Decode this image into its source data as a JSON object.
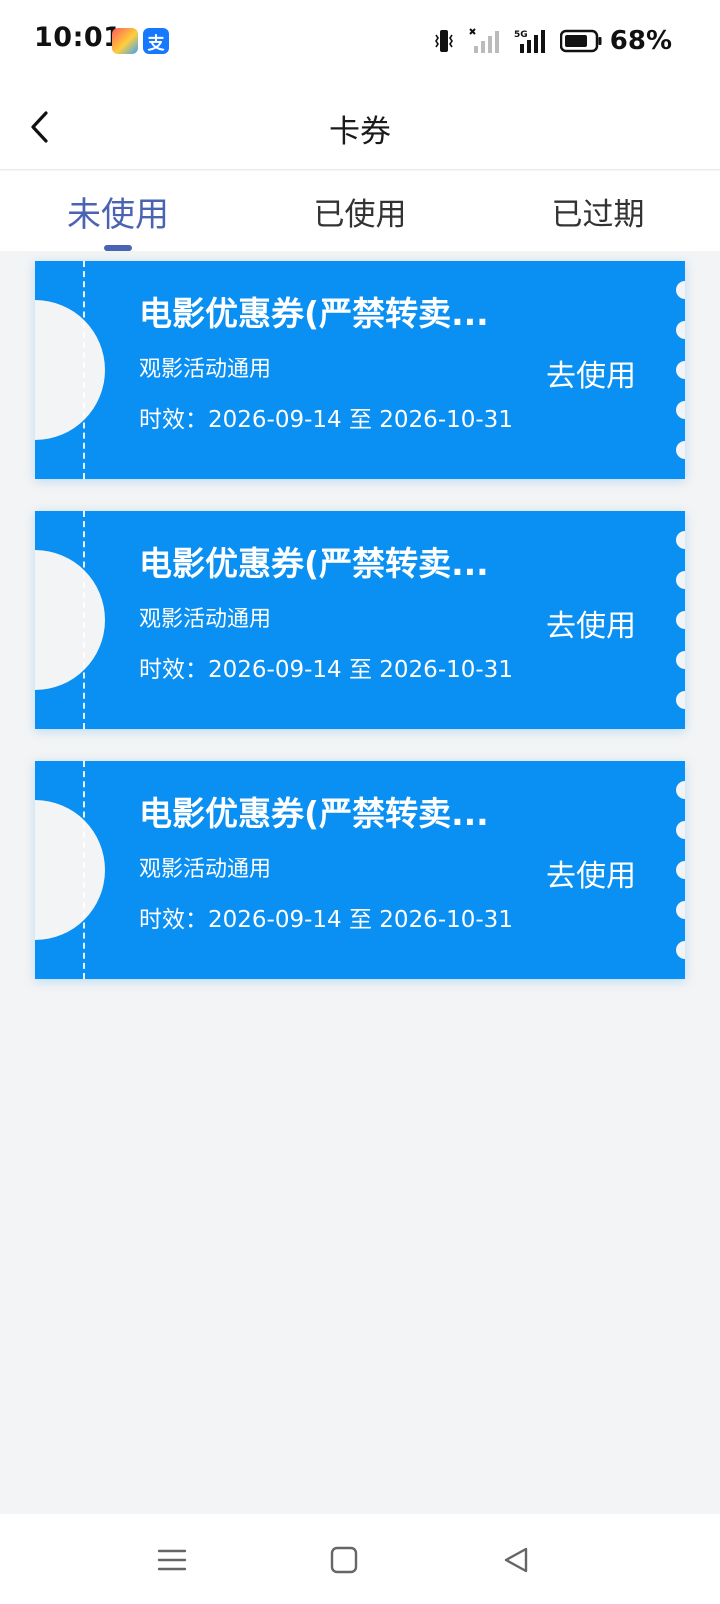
{
  "status_bar": {
    "time": "10:01",
    "battery": "68%",
    "network": "5G",
    "icons": [
      "notification-clown-icon",
      "alipay-icon",
      "vibrate-icon",
      "signal-icon",
      "battery-icon"
    ],
    "alipay_glyph": "支"
  },
  "header": {
    "title": "卡券",
    "back_icon": "chevron-left-icon"
  },
  "tabs": [
    {
      "label": "未使用",
      "active": true
    },
    {
      "label": "已使用",
      "active": false
    },
    {
      "label": "已过期",
      "active": false
    }
  ],
  "coupons": [
    {
      "title": "电影优惠券(严禁转卖...",
      "desc": "观影活动通用",
      "validity": "时效：2026-09-14 至 2026-10-31",
      "action": "去使用"
    },
    {
      "title": "电影优惠券(严禁转卖...",
      "desc": "观影活动通用",
      "validity": "时效：2026-09-14 至 2026-10-31",
      "action": "去使用"
    },
    {
      "title": "电影优惠券(严禁转卖...",
      "desc": "观影活动通用",
      "validity": "时效：2026-09-14 至 2026-10-31",
      "action": "去使用"
    }
  ],
  "system_nav": {
    "icons": [
      "menu-icon",
      "home-icon",
      "back-triangle-icon"
    ]
  },
  "colors": {
    "accent": "#4a63b3",
    "coupon_bg": "#0a8ff2",
    "page_bg": "#f3f4f5"
  }
}
